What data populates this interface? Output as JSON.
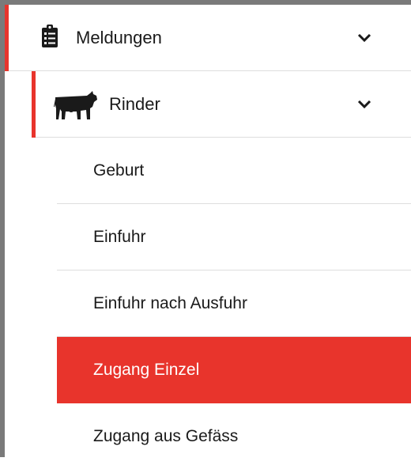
{
  "menu": {
    "section": {
      "label": "Meldungen",
      "icon": "clipboard-list-icon",
      "expanded": true
    },
    "category": {
      "label": "Rinder",
      "icon": "cow-icon",
      "expanded": true
    },
    "items": [
      {
        "label": "Geburt",
        "active": false
      },
      {
        "label": "Einfuhr",
        "active": false
      },
      {
        "label": "Einfuhr nach Ausfuhr",
        "active": false
      },
      {
        "label": "Zugang Einzel",
        "active": true
      },
      {
        "label": "Zugang aus Gefäss",
        "active": false
      }
    ]
  },
  "colors": {
    "accent": "#e8342c",
    "frame": "#7a7a7a",
    "divider": "#dedede",
    "text": "#1a1a1a",
    "active_text": "#ffffff"
  }
}
